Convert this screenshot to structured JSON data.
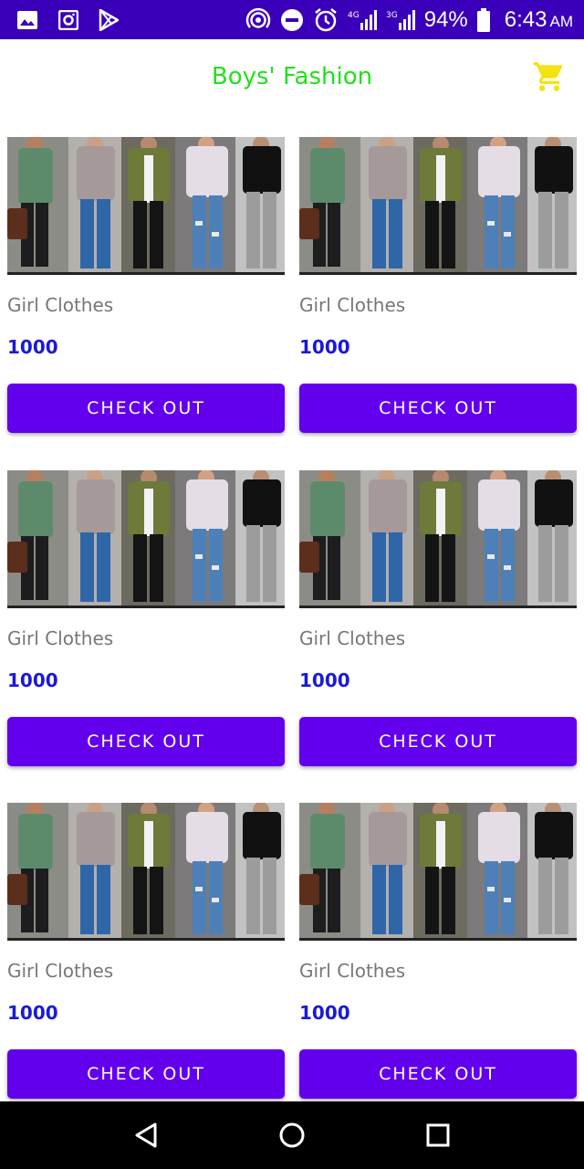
{
  "status_bar": {
    "battery_percent": "94%",
    "time": "6:43",
    "ampm": "AM",
    "network_1": "4G",
    "network_2": "3G",
    "icons": [
      "gallery-icon",
      "camera-icon",
      "play-store-icon",
      "hotspot-icon",
      "do-not-disturb-icon",
      "alarm-icon",
      "signal-4g-icon",
      "signal-3g-icon",
      "battery-icon"
    ]
  },
  "app_bar": {
    "title": "Boys' Fashion",
    "title_color": "#22e01e",
    "cart_icon": "cart-icon",
    "cart_color": "#f5e211"
  },
  "products": [
    {
      "name": "Girl Clothes",
      "price": "1000",
      "button": "CHECK OUT"
    },
    {
      "name": "Girl Clothes",
      "price": "1000",
      "button": "CHECK OUT"
    },
    {
      "name": "Girl Clothes",
      "price": "1000",
      "button": "CHECK OUT"
    },
    {
      "name": "Girl Clothes",
      "price": "1000",
      "button": "CHECK OUT"
    },
    {
      "name": "Girl Clothes",
      "price": "1000",
      "button": "CHECK OUT"
    },
    {
      "name": "Girl Clothes",
      "price": "1000",
      "button": "CHECK OUT"
    }
  ],
  "colors": {
    "status_bar": "#3a00b9",
    "button": "#6200ee",
    "price": "#1a1ad6"
  },
  "nav_bar": {
    "icons": [
      "back-icon",
      "home-icon",
      "recents-icon"
    ]
  }
}
